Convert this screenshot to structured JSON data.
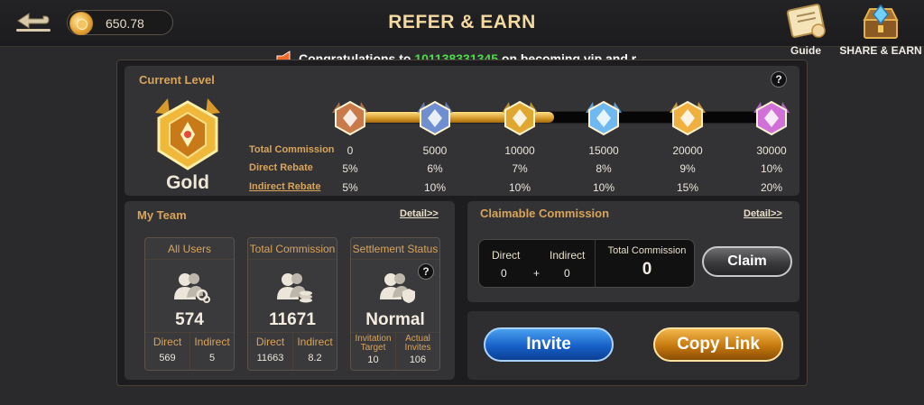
{
  "header": {
    "title": "REFER & EARN",
    "balance": "650.78",
    "guide_label": "Guide",
    "share_label": "SHARE & EARN"
  },
  "marquee": {
    "prefix": "Congratulations to ",
    "user_id": "101138331345",
    "suffix": " on becoming vip and re"
  },
  "current_level": {
    "title": "Current Level",
    "level_name": "Gold",
    "progress": 0.48,
    "row_labels": [
      "Total Commission",
      "Direct Rebate",
      "Indirect Rebate"
    ],
    "tiers": [
      {
        "commission": "0",
        "direct": "5%",
        "indirect": "5%",
        "color": "#c97a4a"
      },
      {
        "commission": "5000",
        "direct": "6%",
        "indirect": "10%",
        "color": "#6f8fd0"
      },
      {
        "commission": "10000",
        "direct": "7%",
        "indirect": "10%",
        "color": "#e0a830"
      },
      {
        "commission": "15000",
        "direct": "8%",
        "indirect": "10%",
        "color": "#6fb8f0"
      },
      {
        "commission": "20000",
        "direct": "9%",
        "indirect": "15%",
        "color": "#f0b040"
      },
      {
        "commission": "30000",
        "direct": "10%",
        "indirect": "20%",
        "color": "#d070d8"
      }
    ]
  },
  "my_team": {
    "title": "My Team",
    "detail_label": "Detail>>",
    "cards": [
      {
        "header": "All Users",
        "value": "574",
        "left_label": "Direct",
        "left_value": "569",
        "right_label": "Indirect",
        "right_value": "5"
      },
      {
        "header": "Total Commission",
        "value": "11671",
        "left_label": "Direct",
        "left_value": "11663",
        "right_label": "Indirect",
        "right_value": "8.2"
      },
      {
        "header": "Settlement Status",
        "value": "Normal",
        "left_label": "Invitation Target",
        "left_value": "10",
        "right_label": "Actual Invites",
        "right_value": "106"
      }
    ]
  },
  "claimable": {
    "title": "Claimable Commission",
    "detail_label": "Detail>>",
    "direct_label": "Direct",
    "direct_value": "0",
    "plus": "+",
    "indirect_label": "Indirect",
    "indirect_value": "0",
    "total_label": "Total Commission",
    "total_value": "0",
    "claim_label": "Claim"
  },
  "actions": {
    "invite_label": "Invite",
    "copy_label": "Copy Link"
  }
}
